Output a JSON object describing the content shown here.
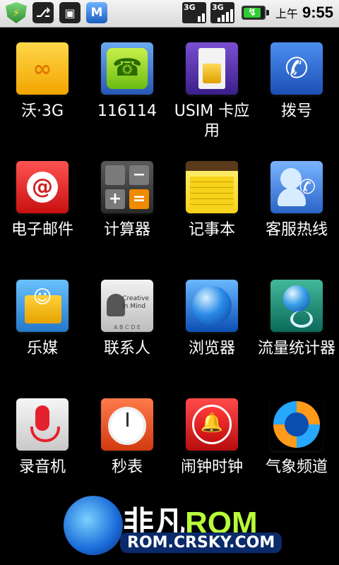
{
  "status_bar": {
    "ampm": "上午",
    "time": "9:55",
    "network_label_1": "3G",
    "network_label_2": "3G"
  },
  "apps": [
    {
      "label": "沃·3G",
      "icon": "wo-3g-icon"
    },
    {
      "label": "116114",
      "icon": "call-arrow-icon"
    },
    {
      "label": "USIM 卡应用",
      "icon": "sim-card-icon"
    },
    {
      "label": "拨号",
      "icon": "phone-icon"
    },
    {
      "label": "电子邮件",
      "icon": "email-icon"
    },
    {
      "label": "计算器",
      "icon": "calculator-icon"
    },
    {
      "label": "记事本",
      "icon": "notepad-icon"
    },
    {
      "label": "客服热线",
      "icon": "customer-service-icon"
    },
    {
      "label": "乐媒",
      "icon": "media-folder-icon"
    },
    {
      "label": "联系人",
      "icon": "contacts-icon"
    },
    {
      "label": "浏览器",
      "icon": "globe-icon"
    },
    {
      "label": "流量统计器",
      "icon": "traffic-globe-icon"
    },
    {
      "label": "录音机",
      "icon": "microphone-icon"
    },
    {
      "label": "秒表",
      "icon": "stopwatch-icon"
    },
    {
      "label": "闹钟时钟",
      "icon": "alarm-bell-icon"
    },
    {
      "label": "气象频道",
      "icon": "weather-channel-icon"
    }
  ],
  "watermark": {
    "brand_cn": "非凡",
    "brand_en": "ROM",
    "url": "ROM.CRSKY.COM"
  },
  "icon_text": {
    "contacts_text": "Creative\nin Mind",
    "contacts_tabs": "A B C D E"
  }
}
